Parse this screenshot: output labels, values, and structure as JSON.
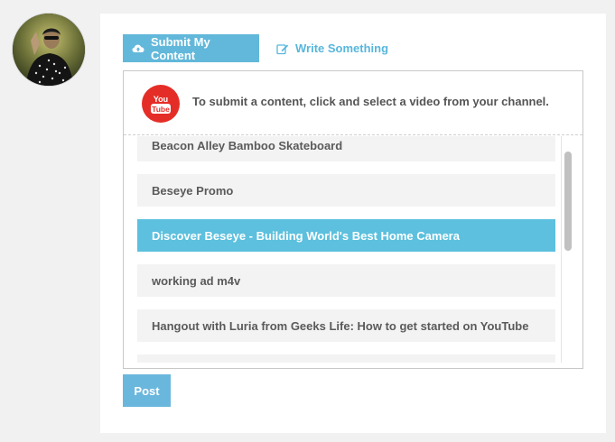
{
  "tabs": {
    "submit": {
      "label": "Submit My Content",
      "icon": "cloud-upload-icon"
    },
    "write": {
      "label": "Write Something",
      "icon": "edit-icon"
    }
  },
  "youtube": {
    "badge_icon": "youtube-icon",
    "logo_you": "You",
    "logo_tube": "Tube"
  },
  "instruction": "To submit a content, click and select a video from your channel.",
  "videos": [
    {
      "title": "Beacon Alley Bamboo Skateboard",
      "selected": false
    },
    {
      "title": "Beseye Promo",
      "selected": false
    },
    {
      "title": "Discover Beseye - Building World's Best Home Camera",
      "selected": true
    },
    {
      "title": "working ad m4v",
      "selected": false
    },
    {
      "title": "Hangout with Luria from Geeks Life: How to get started on YouTube",
      "selected": false
    },
    {
      "title": "",
      "selected": false
    }
  ],
  "post_label": "Post",
  "colors": {
    "accent": "#5cc0de",
    "tab_active": "#62b8da",
    "youtube_red": "#e52d27",
    "item_bg": "#f3f3f3"
  }
}
